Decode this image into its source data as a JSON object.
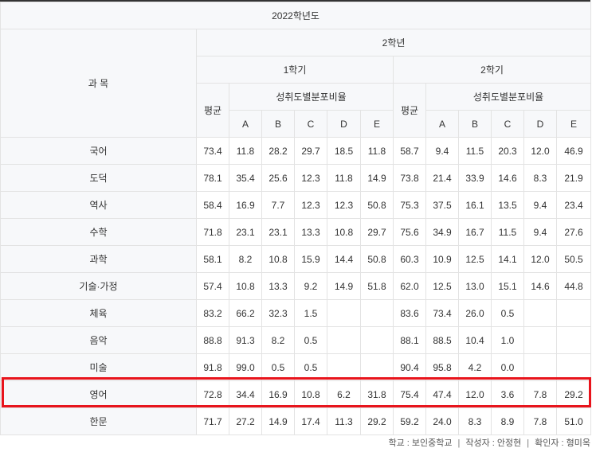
{
  "header": {
    "year": "2022학년도",
    "subject_label": "과 목",
    "grade": "2학년",
    "semesters": [
      "1학기",
      "2학기"
    ],
    "avg_label": "평균",
    "dist_label": "성취도별분포비율",
    "levels": [
      "A",
      "B",
      "C",
      "D",
      "E"
    ]
  },
  "rows": [
    {
      "subject": "국어",
      "s1": [
        "73.4",
        "11.8",
        "28.2",
        "29.7",
        "18.5",
        "11.8"
      ],
      "s2": [
        "58.7",
        "9.4",
        "11.5",
        "20.3",
        "12.0",
        "46.9"
      ]
    },
    {
      "subject": "도덕",
      "s1": [
        "78.1",
        "35.4",
        "25.6",
        "12.3",
        "11.8",
        "14.9"
      ],
      "s2": [
        "73.8",
        "21.4",
        "33.9",
        "14.6",
        "8.3",
        "21.9"
      ]
    },
    {
      "subject": "역사",
      "s1": [
        "58.4",
        "16.9",
        "7.7",
        "12.3",
        "12.3",
        "50.8"
      ],
      "s2": [
        "75.3",
        "37.5",
        "16.1",
        "13.5",
        "9.4",
        "23.4"
      ]
    },
    {
      "subject": "수학",
      "s1": [
        "71.8",
        "23.1",
        "23.1",
        "13.3",
        "10.8",
        "29.7"
      ],
      "s2": [
        "75.6",
        "34.9",
        "16.7",
        "11.5",
        "9.4",
        "27.6"
      ]
    },
    {
      "subject": "과학",
      "s1": [
        "58.1",
        "8.2",
        "10.8",
        "15.9",
        "14.4",
        "50.8"
      ],
      "s2": [
        "60.3",
        "10.9",
        "12.5",
        "14.1",
        "12.0",
        "50.5"
      ]
    },
    {
      "subject": "기술·가정",
      "s1": [
        "57.4",
        "10.8",
        "13.3",
        "9.2",
        "14.9",
        "51.8"
      ],
      "s2": [
        "62.0",
        "12.5",
        "13.0",
        "15.1",
        "14.6",
        "44.8"
      ]
    },
    {
      "subject": "체육",
      "s1": [
        "83.2",
        "66.2",
        "32.3",
        "1.5",
        "",
        ""
      ],
      "s2": [
        "83.6",
        "73.4",
        "26.0",
        "0.5",
        "",
        ""
      ]
    },
    {
      "subject": "음악",
      "s1": [
        "88.8",
        "91.3",
        "8.2",
        "0.5",
        "",
        ""
      ],
      "s2": [
        "88.1",
        "88.5",
        "10.4",
        "1.0",
        "",
        ""
      ]
    },
    {
      "subject": "미술",
      "s1": [
        "91.8",
        "99.0",
        "0.5",
        "0.5",
        "",
        ""
      ],
      "s2": [
        "90.4",
        "95.8",
        "4.2",
        "0.0",
        "",
        ""
      ]
    },
    {
      "subject": "영어",
      "s1": [
        "72.8",
        "34.4",
        "16.9",
        "10.8",
        "6.2",
        "31.8"
      ],
      "s2": [
        "75.4",
        "47.4",
        "12.0",
        "3.6",
        "7.8",
        "29.2"
      ]
    },
    {
      "subject": "한문",
      "s1": [
        "71.7",
        "27.2",
        "14.9",
        "17.4",
        "11.3",
        "29.2"
      ],
      "s2": [
        "59.2",
        "24.0",
        "8.3",
        "8.9",
        "7.8",
        "51.0"
      ]
    }
  ],
  "highlight_color": "#e8141c",
  "footer": {
    "school": "학교 : 보인중학교",
    "author": "작성자 : 안정현",
    "verifier": "확인자 : 형미옥",
    "separator": "|"
  }
}
